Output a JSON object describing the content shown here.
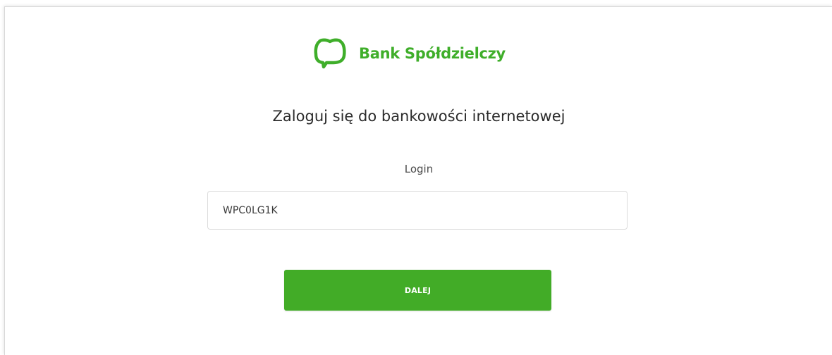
{
  "brand": {
    "name": "Bank Spółdzielczy",
    "logo_icon": "speech-bubble-leaf-icon",
    "accent_color": "#3fae2a"
  },
  "login_form": {
    "heading": "Zaloguj się do bankowości internetowej",
    "login_label": "Login",
    "login_value": "WPC0LG1K",
    "submit_label": "DALEJ",
    "button_color": "#42ac27"
  }
}
